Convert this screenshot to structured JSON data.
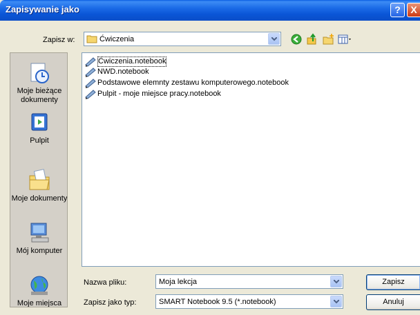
{
  "window": {
    "title": "Zapisywanie jako",
    "help_glyph": "?",
    "close_glyph": "X"
  },
  "lookin": {
    "label": "Zapisz w:",
    "value": "Ćwiczenia"
  },
  "toolbar": {
    "icons": [
      "back-icon",
      "up-folder-icon",
      "new-folder-icon",
      "view-menu-icon"
    ]
  },
  "places": [
    {
      "label": "Moje bieżące dokumenty",
      "icon": "recent-documents-icon"
    },
    {
      "label": "Pulpit",
      "icon": "desktop-icon"
    },
    {
      "label": "Moje dokumenty",
      "icon": "my-documents-icon"
    },
    {
      "label": "Mój komputer",
      "icon": "my-computer-icon"
    },
    {
      "label": "Moje miejsca",
      "icon": "network-places-icon"
    }
  ],
  "files": [
    {
      "name": "Ćwiczenia.notebook",
      "focused": true
    },
    {
      "name": "NWD.notebook",
      "focused": false
    },
    {
      "name": "Podstawowe elemnty zestawu komputerowego.notebook",
      "focused": false
    },
    {
      "name": "Pulpit - moje miejsce pracy.notebook",
      "focused": false
    }
  ],
  "filename": {
    "label": "Nazwa pliku:",
    "value": "Moja lekcja"
  },
  "filetype": {
    "label": "Zapisz jako typ:",
    "value": "SMART Notebook 9.5 (*.notebook)"
  },
  "buttons": {
    "save": "Zapisz",
    "cancel": "Anuluj"
  },
  "colors": {
    "titlebar": "#0a55d6",
    "dialog_bg": "#ece9d8",
    "places_bg": "#d4d0c8"
  }
}
